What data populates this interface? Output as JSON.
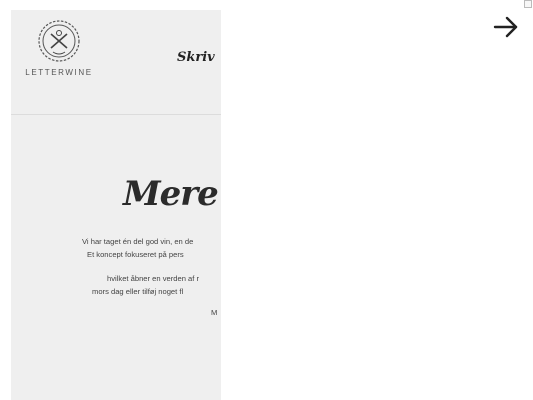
{
  "brand": {
    "name": "LETTERWINE"
  },
  "nav": {
    "item": "Skriv"
  },
  "hero": {
    "heading": "Mere en"
  },
  "body_text": {
    "line1": "Vi har taget én del god vin, en de",
    "line2": "Et koncept fokuseret på pers",
    "line3": "hvilket åbner en verden af r",
    "line4": "mors dag eller tilføj noget fl",
    "line5": "M"
  },
  "icons": {
    "next": "arrow-right-icon",
    "corner": "window-control-icon"
  }
}
